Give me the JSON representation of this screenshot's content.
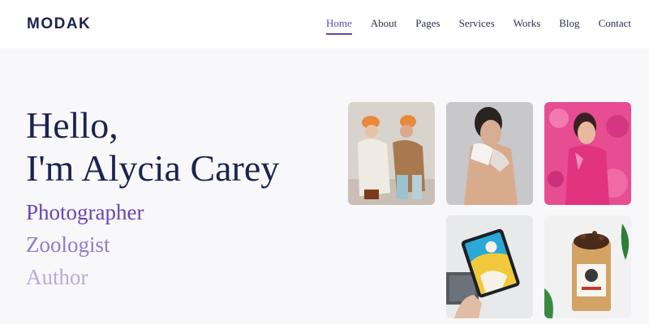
{
  "header": {
    "logo": "MODAK",
    "nav": [
      "Home",
      "About",
      "Pages",
      "Services",
      "Works",
      "Blog",
      "Contact"
    ]
  },
  "hero": {
    "line1": "Hello,",
    "line2": "I'm Alycia Carey",
    "roles": [
      "Photographer",
      "Zoologist",
      "Author"
    ]
  },
  "colors": {
    "brand": "#1b2350",
    "accent": "#5a4ba8",
    "role1": "#6846b2",
    "role2": "#8f7cc8",
    "role3": "#b8aadd"
  }
}
